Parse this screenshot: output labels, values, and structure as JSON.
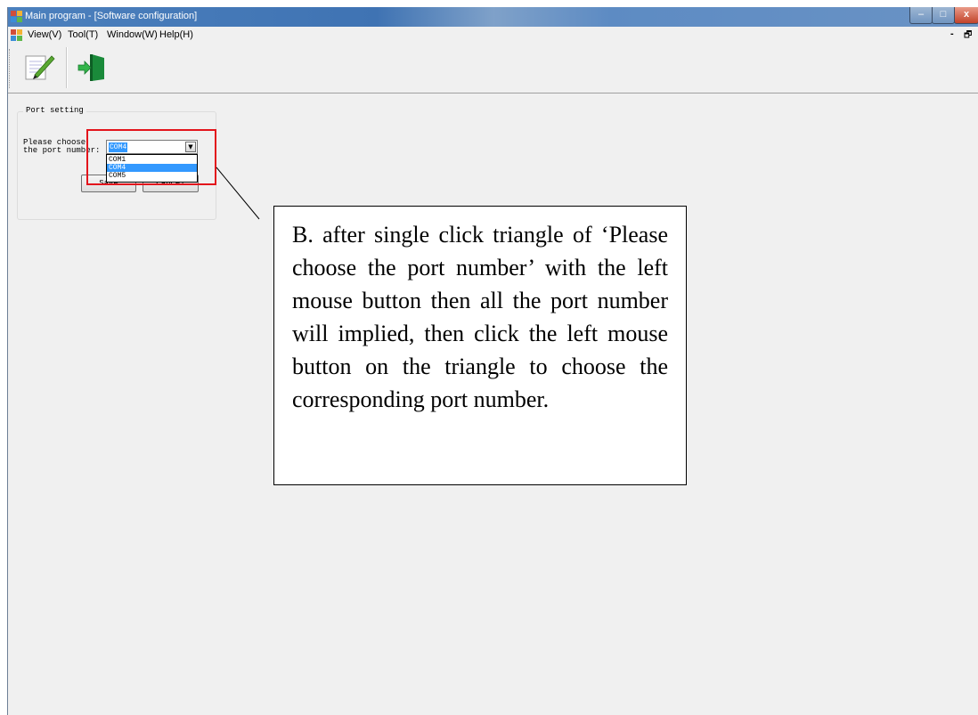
{
  "window": {
    "title": "Main program - [Software configuration]",
    "controls": {
      "minimize": "–",
      "maximize": "□",
      "close": "x"
    }
  },
  "menu": {
    "items": [
      "View(V)",
      "Tool(T)",
      "Window(W)",
      "Help(H)"
    ],
    "mdi_min": "-",
    "mdi_restore": "🗗"
  },
  "toolbar": {
    "buttons": [
      {
        "name": "edit-icon",
        "tooltip": ""
      },
      {
        "name": "exit-icon",
        "tooltip": ""
      }
    ]
  },
  "port_setting": {
    "group_title": "Port setting",
    "label_line1": "Please choose",
    "label_line2": "the port number:",
    "selected_value": "COM4",
    "options": [
      "COM1",
      "COM4",
      "COM5"
    ],
    "highlighted_index": 1,
    "save_label": "Save",
    "cancel_label": "Cancel"
  },
  "annotation": {
    "text": "B. after single click triangle of ‘Please choose the port number’ with the left mouse button then all the port number will implied, then click the left mouse button on the triangle to choose the corresponding port number."
  },
  "colors": {
    "highlight": "#3399ff",
    "annotation_box": "#e3141c"
  }
}
